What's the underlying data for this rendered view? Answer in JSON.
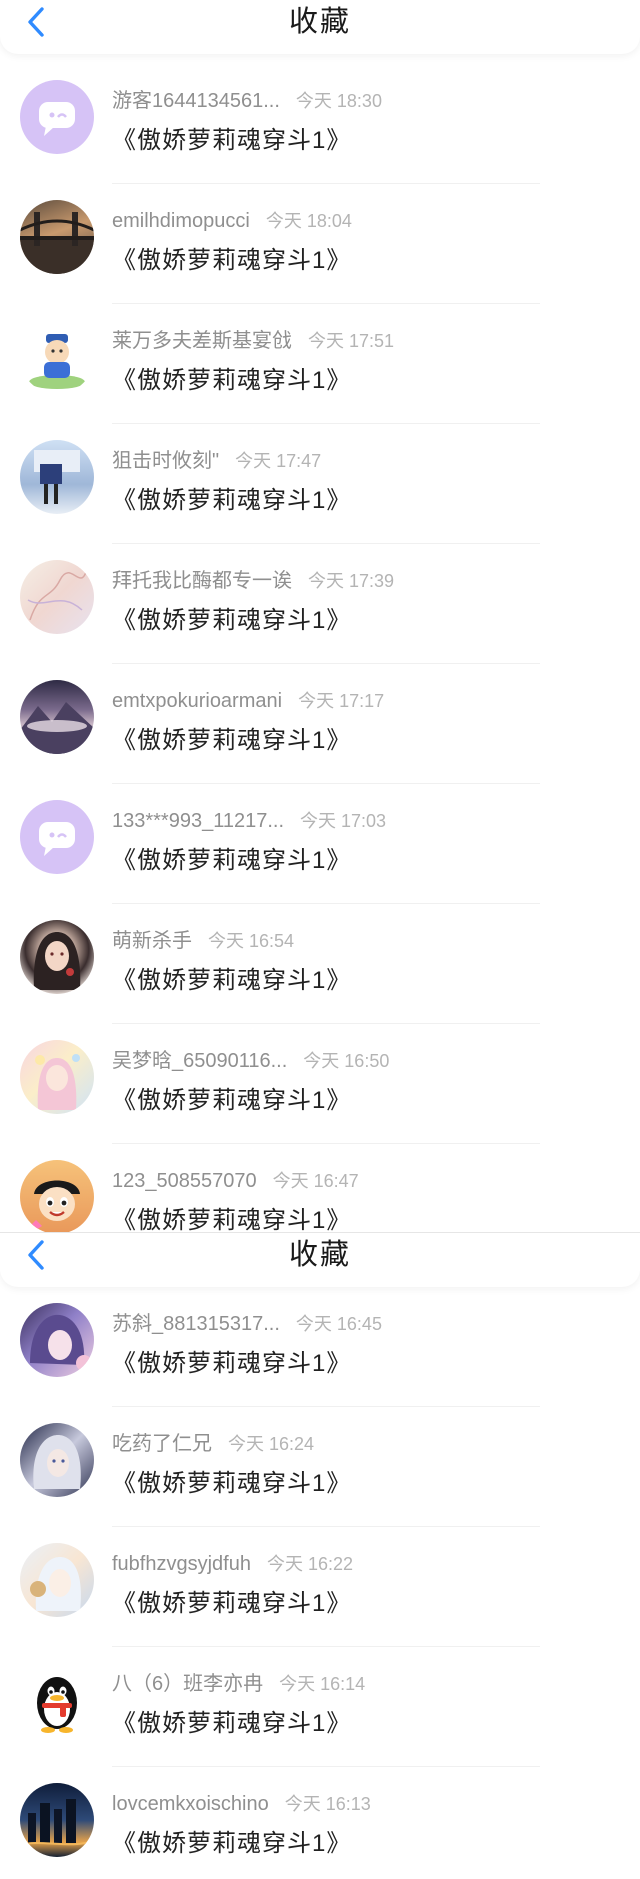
{
  "header": {
    "title": "收藏",
    "back_icon": "chevron-left-icon",
    "accent_color": "#2f8bff"
  },
  "screen1": {
    "items": [
      {
        "name": "游客1644134561...",
        "time": "今天 18:30",
        "title": "《傲娇萝莉魂穿斗1》",
        "avatar": "chat-bubble-icon"
      },
      {
        "name": "emilhdimopucci",
        "time": "今天 18:04",
        "title": "《傲娇萝莉魂穿斗1》",
        "avatar": "bridge-photo"
      },
      {
        "name": "莱万多夫差斯基宴戗",
        "time": "今天 17:51",
        "title": "《傲娇萝莉魂穿斗1》",
        "avatar": "cartoon-kid"
      },
      {
        "name": "狙击时攸刻\"",
        "time": "今天 17:47",
        "title": "《傲娇萝莉魂穿斗1》",
        "avatar": "school-uniform"
      },
      {
        "name": "拜托我比酶都专一诶",
        "time": "今天 17:39",
        "title": "《傲娇萝莉魂穿斗1》",
        "avatar": "sketch-art"
      },
      {
        "name": "emtxpokurioarmani",
        "time": "今天 17:17",
        "title": "《傲娇萝莉魂穿斗1》",
        "avatar": "mountain-art"
      },
      {
        "name": "133***993_11217...",
        "time": "今天 17:03",
        "title": "《傲娇萝莉魂穿斗1》",
        "avatar": "chat-bubble-icon"
      },
      {
        "name": "萌新杀手",
        "time": "今天 16:54",
        "title": "《傲娇萝莉魂穿斗1》",
        "avatar": "girl-portrait"
      },
      {
        "name": "吴梦晗_65090116...",
        "time": "今天 16:50",
        "title": "《傲娇萝莉魂穿斗1》",
        "avatar": "pastel-art"
      },
      {
        "name": "123_508557070",
        "time": "今天 16:47",
        "title": "《傲娇萝莉魂穿斗1》",
        "avatar": "luffy-cartoon"
      }
    ]
  },
  "screen2": {
    "items": [
      {
        "name": "苏斜_881315317...",
        "time": "今天 16:45",
        "title": "《傲娇萝莉魂穿斗1》",
        "avatar": "anime-purple"
      },
      {
        "name": "吃药了仁兄",
        "time": "今天 16:24",
        "title": "《傲娇萝莉魂穿斗1》",
        "avatar": "anime-silver"
      },
      {
        "name": "fubfhzvgsyjdfuh",
        "time": "今天 16:22",
        "title": "《傲娇萝莉魂穿斗1》",
        "avatar": "anime-light"
      },
      {
        "name": "八（6）班李亦冉",
        "time": "今天 16:14",
        "title": "《傲娇萝莉魂穿斗1》",
        "avatar": "qq-penguin-icon"
      },
      {
        "name": "lovcemkxoischino",
        "time": "今天 16:13",
        "title": "《傲娇萝莉魂穿斗1》",
        "avatar": "city-night"
      }
    ]
  }
}
